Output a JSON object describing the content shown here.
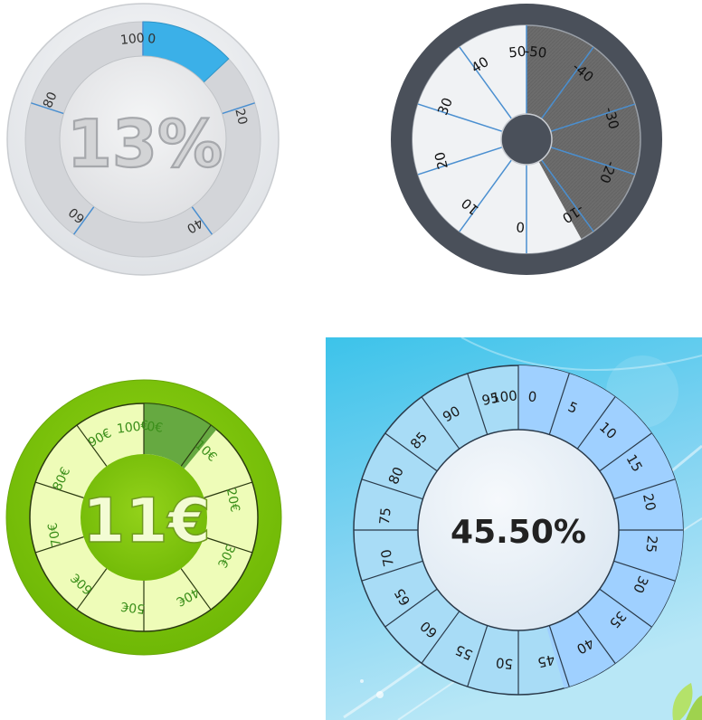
{
  "gauges": [
    {
      "id": "gray-percent",
      "value_label": "13%",
      "value": 13,
      "range": [
        0,
        100
      ],
      "ticks": [
        {
          "text": "0"
        },
        {
          "text": "20"
        },
        {
          "text": "40"
        },
        {
          "text": "60"
        },
        {
          "text": "80"
        },
        {
          "text": "100"
        }
      ],
      "colors": {
        "fill": "#3bb0e8",
        "track": "#d4d6da",
        "outer": "#eceef1",
        "tick": "#4a8fd0"
      }
    },
    {
      "id": "dark-signed",
      "value": 8,
      "range": [
        -50,
        50
      ],
      "ticks": [
        {
          "text": "50"
        },
        {
          "text": "-40"
        },
        {
          "text": "-30"
        },
        {
          "text": "-20"
        },
        {
          "text": "-10"
        },
        {
          "text": "0"
        },
        {
          "text": "10"
        },
        {
          "text": "20"
        },
        {
          "text": "30"
        },
        {
          "text": "40"
        },
        {
          "text": "-50"
        }
      ],
      "colors": {
        "rim": "#4a505a",
        "face": "#6b6b6b",
        "fill": "#f0f2f4",
        "hub": "#4a505a",
        "divider": "#4a8fd0"
      }
    },
    {
      "id": "green-euro",
      "value_label": "11€",
      "value": 11,
      "range": [
        0,
        100
      ],
      "ticks": [
        {
          "text": "0€"
        },
        {
          "text": "10€"
        },
        {
          "text": "20€"
        },
        {
          "text": "30€"
        },
        {
          "text": "40€"
        },
        {
          "text": "50€"
        },
        {
          "text": "60€"
        },
        {
          "text": "70€"
        },
        {
          "text": "80€"
        },
        {
          "text": "90€"
        },
        {
          "text": "100€"
        }
      ],
      "colors": {
        "rim": "#7cc50a",
        "face": "#eefcb8",
        "fill": "#4e9a2c",
        "center": "#85c80d",
        "tick_text": "#3b8f1a"
      }
    },
    {
      "id": "blue-percent",
      "value_label": "45.50%",
      "value": 45.5,
      "range": [
        0,
        100
      ],
      "ticks": [
        {
          "text": "0"
        },
        {
          "text": "5"
        },
        {
          "text": "10"
        },
        {
          "text": "15"
        },
        {
          "text": "20"
        },
        {
          "text": "25"
        },
        {
          "text": "30"
        },
        {
          "text": "35"
        },
        {
          "text": "40"
        },
        {
          "text": "45"
        },
        {
          "text": "50"
        },
        {
          "text": "55"
        },
        {
          "text": "60"
        },
        {
          "text": "65"
        },
        {
          "text": "70"
        },
        {
          "text": "75"
        },
        {
          "text": "80"
        },
        {
          "text": "85"
        },
        {
          "text": "90"
        },
        {
          "text": "95"
        },
        {
          "text": "100"
        }
      ],
      "colors": {
        "bg_top": "#3dc5ea",
        "bg_bottom": "#a9e2f4",
        "face": "#a8dcf6",
        "fill": "#9fd0ff",
        "center": "#eef4fa",
        "line": "#2a3a4a",
        "leaf": "#b4e26a"
      }
    }
  ]
}
